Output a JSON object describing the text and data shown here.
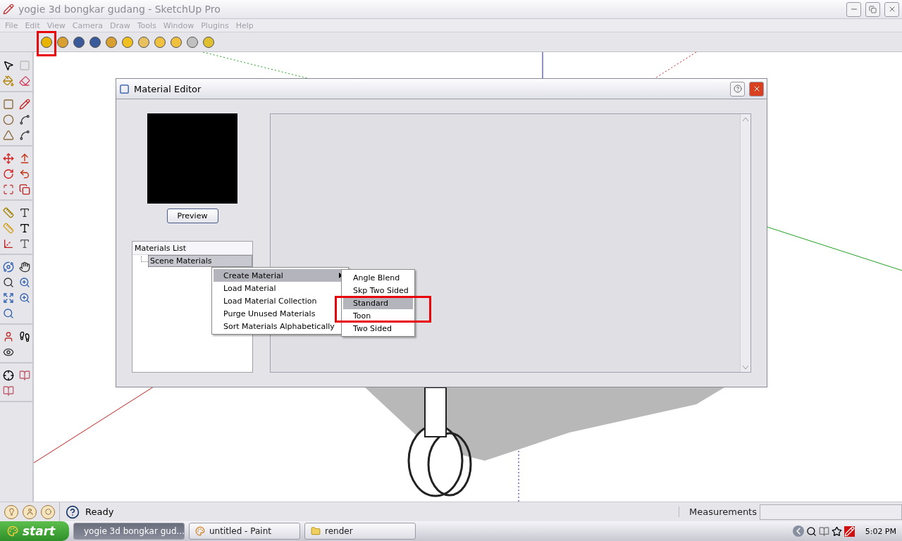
{
  "window": {
    "title": "yogie 3d bongkar gudang - SketchUp Pro"
  },
  "menu_bar": [
    {
      "label": "File",
      "disabled": true
    },
    {
      "label": "Edit",
      "disabled": true
    },
    {
      "label": "View",
      "disabled": true
    },
    {
      "label": "Camera",
      "disabled": true
    },
    {
      "label": "Draw",
      "disabled": true
    },
    {
      "label": "Tools",
      "disabled": true
    },
    {
      "label": "Window",
      "disabled": true
    },
    {
      "label": "Plugins",
      "disabled": true
    },
    {
      "label": "Help",
      "disabled": true
    }
  ],
  "dialog": {
    "title": "Material Editor",
    "preview_button": "Preview",
    "materials_list": {
      "header": "Materials List",
      "items": [
        {
          "label": "Scene Materials",
          "selected": true
        }
      ]
    },
    "context_menu": [
      {
        "label": "Create Material",
        "selected": true,
        "has_submenu": true
      },
      {
        "label": "Load Material",
        "selected": false,
        "has_submenu": false
      },
      {
        "label": "Load Material Collection",
        "selected": false,
        "has_submenu": false
      },
      {
        "label": "Purge Unused Materials",
        "selected": false,
        "has_submenu": false
      },
      {
        "label": "Sort Materials Alphabetically",
        "selected": false,
        "has_submenu": false
      }
    ],
    "submenu": [
      {
        "label": "Angle Blend",
        "selected": false
      },
      {
        "label": "Skp Two Sided",
        "selected": false
      },
      {
        "label": "Standard",
        "selected": true
      },
      {
        "label": "Toon",
        "selected": false
      },
      {
        "label": "Two Sided",
        "selected": false
      }
    ]
  },
  "status_bar": {
    "text": "Ready",
    "measurements_label": "Measurements"
  },
  "taskbar": {
    "start": "start",
    "tasks": [
      {
        "label": "yogie 3d bongkar gud...",
        "selected": true,
        "kind": "sketchup"
      },
      {
        "label": "untitled - Paint",
        "selected": false,
        "kind": "paint"
      },
      {
        "label": "render",
        "selected": false,
        "kind": "folder"
      }
    ],
    "clock": "5:02 PM"
  }
}
